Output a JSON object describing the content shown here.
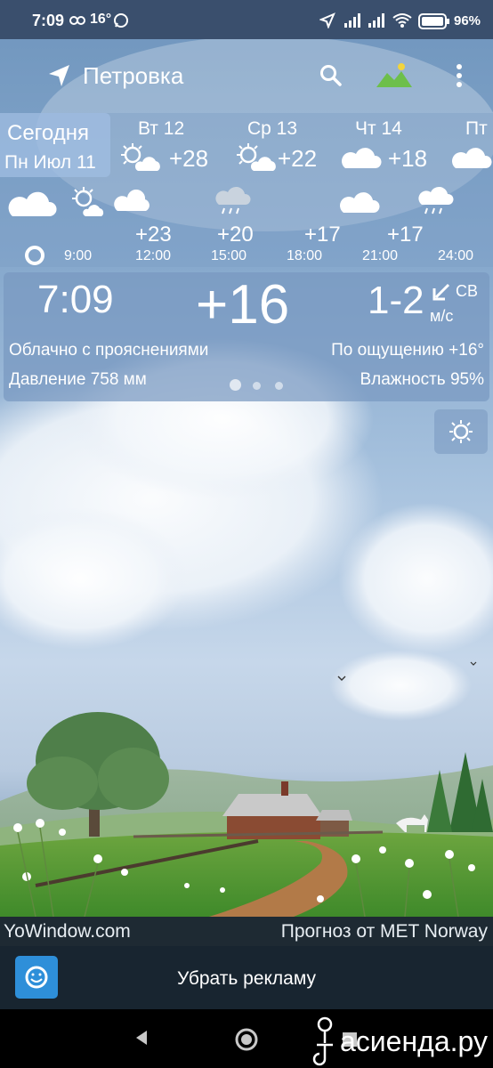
{
  "status_bar": {
    "time": "7:09",
    "temperature": "16°",
    "battery": "96%"
  },
  "app_bar": {
    "location": "Петровка",
    "icons": [
      "navigation-arrow-icon",
      "search-icon",
      "landscape-icon",
      "more-vert-icon"
    ]
  },
  "forecast": {
    "today": {
      "label": "Сегодня",
      "date": "Пн Июл 11"
    },
    "days": [
      {
        "name": "Вт 12",
        "temp": "+28",
        "icon": "partly-cloudy-icon"
      },
      {
        "name": "Ср 13",
        "temp": "+22",
        "icon": "partly-cloudy-icon"
      },
      {
        "name": "Чт 14",
        "temp": "+18",
        "icon": "cloud-icon"
      },
      {
        "name": "Пт",
        "temp": "",
        "icon": "cloud-icon"
      }
    ],
    "hours": [
      {
        "time": "9:00",
        "temp": "",
        "icon": "cloud-icon"
      },
      {
        "time": "12:00",
        "temp": "+23",
        "icon": "partly-cloudy-icon"
      },
      {
        "time": "15:00",
        "temp": "+20",
        "icon": "cloud-icon"
      },
      {
        "time": "18:00",
        "temp": "+17",
        "icon": "rain-cloud-icon"
      },
      {
        "time": "21:00",
        "temp": "+17",
        "icon": "cloud-icon"
      },
      {
        "time": "24:00",
        "temp": "",
        "icon": "rain-cloud-icon"
      }
    ]
  },
  "current": {
    "time": "7:09",
    "temp": "+16",
    "wind": "1-2",
    "wind_direction": "СВ",
    "wind_unit": "м/с",
    "condition": "Облачно с прояснениями",
    "feels_like": "По ощущению +16°",
    "pressure": "Давление 758 мм",
    "humidity": "Влажность 95%"
  },
  "footer": {
    "brand": "YoWindow.com",
    "provider": "Прогноз от MET Norway",
    "remove_ads": "Убрать рекламу",
    "watermark": "асиенда.ру"
  },
  "colors": {
    "status_bar": "#3a4f6d",
    "ad_bar": "#182530",
    "ad_icon": "#2e8fd9"
  }
}
